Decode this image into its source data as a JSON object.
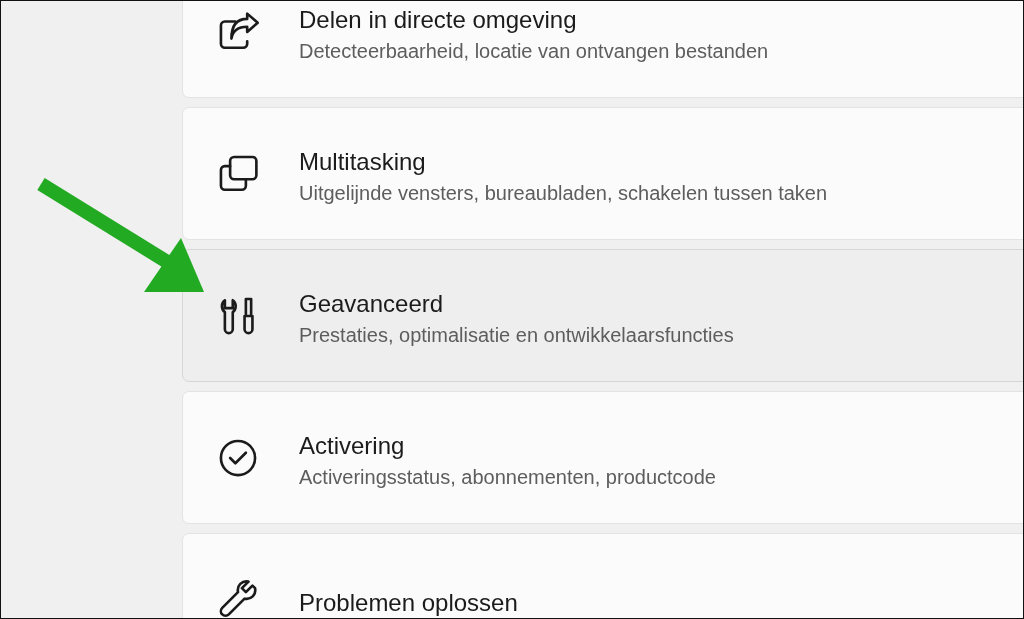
{
  "items": [
    {
      "title": "Delen in directe omgeving",
      "subtitle": "Detecteerbaarheid, locatie van ontvangen bestanden",
      "selected": false
    },
    {
      "title": "Multitasking",
      "subtitle": "Uitgelijnde vensters, bureaubladen, schakelen tussen taken",
      "selected": false
    },
    {
      "title": "Geavanceerd",
      "subtitle": "Prestaties, optimalisatie en ontwikkelaarsfuncties",
      "selected": true
    },
    {
      "title": "Activering",
      "subtitle": "Activeringsstatus, abonnementen, productcode",
      "selected": false
    },
    {
      "title": "Problemen oplossen",
      "selected": false
    }
  ],
  "annotation": {
    "kind": "arrow"
  }
}
